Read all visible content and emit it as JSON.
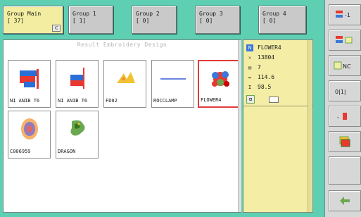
{
  "tabs": [
    {
      "line1": "Group Main",
      "line2": "[ 37]",
      "active": true,
      "icon": "dropdown-icon"
    },
    {
      "line1": "Group 1",
      "line2": "[ 1]",
      "active": false
    },
    {
      "line1": "Group 2",
      "line2": "[ 0]",
      "active": false
    },
    {
      "line1": "Group 3",
      "line2": "[ 0]",
      "active": false
    },
    {
      "line1": "Group 4",
      "line2": "[ 0]",
      "active": false
    }
  ],
  "main": {
    "title": "Result Embroidery Design",
    "designs": [
      {
        "name": "NI ANIB T6",
        "icon": "embroidery-flag-icon"
      },
      {
        "name": "NI ANIB T6",
        "icon": "embroidery-flag-icon"
      },
      {
        "name": "FD02",
        "icon": "yellow-shape-icon"
      },
      {
        "name": "ROCCLAMP",
        "icon": "line-icon"
      },
      {
        "name": "FLOWER4",
        "icon": "flower-icon",
        "selected": true
      },
      {
        "name": "C006959",
        "icon": "round-pattern-icon"
      },
      {
        "name": "DRAGON",
        "icon": "dragon-icon"
      }
    ]
  },
  "detail": {
    "name": "FLOWER4",
    "stitches": "13804",
    "colors": "7",
    "width": "114.6",
    "height": "98.5"
  },
  "toolbar": {
    "buttons": [
      "2-1",
      "2-C",
      "NC",
      "0||1",
      "-8",
      "copy",
      "",
      "",
      "arrow"
    ]
  },
  "colors": {
    "background": "#5fcfb4",
    "active_tab": "#f2eda0",
    "detail_panel": "#f3eda5",
    "selection": "#e23a3a"
  }
}
